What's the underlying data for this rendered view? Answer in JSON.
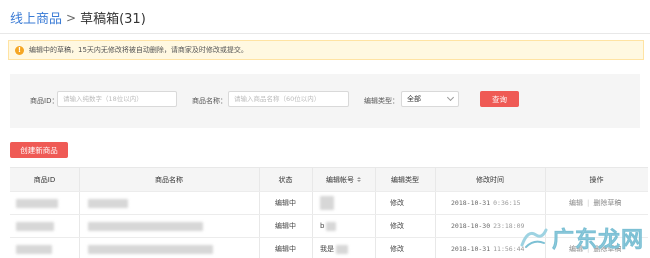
{
  "breadcrumb": {
    "parent": "线上商品",
    "separator": ">",
    "current": "草稿箱(31)"
  },
  "notice": {
    "text": "编辑中的草稿，15天内无修改将被自动删除，请商家及时修改或提交。"
  },
  "filter": {
    "id_label": "商品ID：",
    "id_placeholder": "请输入纯数字（18位以内）",
    "name_label": "商品名称：",
    "name_placeholder": "请输入商品名称（60位以内）",
    "type_label": "编辑类型：",
    "type_value": "全部",
    "query_button": "查询"
  },
  "create_button": "创建新商品",
  "table": {
    "columns": [
      "商品ID",
      "商品名称",
      "状态",
      "编辑帐号",
      "编辑类型",
      "修改时间",
      "操作"
    ],
    "rows": [
      {
        "status": "编辑中",
        "account": "",
        "type": "修改",
        "date": "2018-10-31",
        "time": "0:36:15",
        "ops": [
          "编辑",
          "删除草稿"
        ]
      },
      {
        "status": "编辑中",
        "account": "b",
        "type": "修改",
        "date": "2018-10-30",
        "time": "23:18:09",
        "ops": []
      },
      {
        "status": "编辑中",
        "account": "我是",
        "type": "修改",
        "date": "2018-10-31",
        "time": "11:56:44",
        "ops": [
          "编辑",
          "删除草稿"
        ]
      }
    ]
  },
  "watermark": {
    "text": "广东龙网"
  },
  "colors": {
    "accent": "#ef5a55",
    "link": "#3a7bd5",
    "notice_bg": "#fff8e1",
    "watermark": "#9ed3e2"
  }
}
